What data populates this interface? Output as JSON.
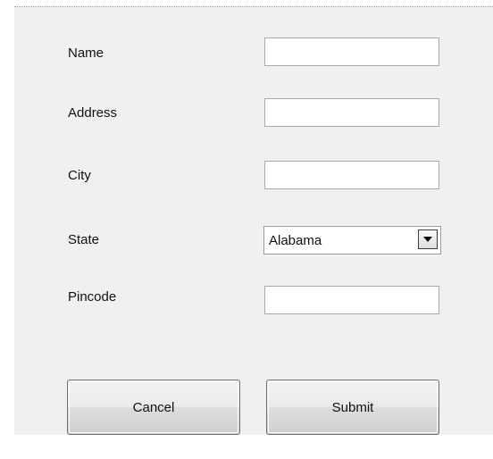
{
  "form": {
    "fields": {
      "name": {
        "label": "Name",
        "value": ""
      },
      "address": {
        "label": "Address",
        "value": ""
      },
      "city": {
        "label": "City",
        "value": ""
      },
      "state": {
        "label": "State",
        "selected": "Alabama"
      },
      "pincode": {
        "label": "Pincode",
        "value": ""
      }
    },
    "buttons": {
      "cancel": "Cancel",
      "submit": "Submit"
    }
  }
}
